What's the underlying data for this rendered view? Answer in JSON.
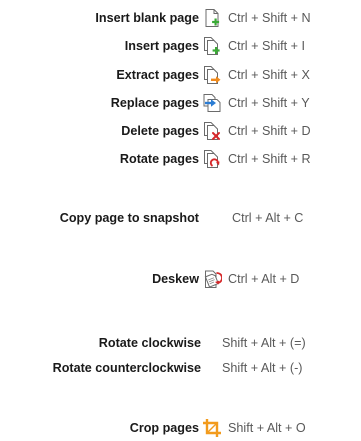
{
  "page_commands": [
    {
      "label": "Insert blank page",
      "shortcut": "Ctrl + Shift + N",
      "icon": "insert-blank-page-icon"
    },
    {
      "label": "Insert pages",
      "shortcut": "Ctrl + Shift + I",
      "icon": "insert-pages-icon"
    },
    {
      "label": "Extract pages",
      "shortcut": "Ctrl + Shift + X",
      "icon": "extract-pages-icon"
    },
    {
      "label": "Replace pages",
      "shortcut": "Ctrl + Shift + Y",
      "icon": "replace-pages-icon"
    },
    {
      "label": "Delete pages",
      "shortcut": "Ctrl + Shift + D",
      "icon": "delete-pages-icon"
    },
    {
      "label": "Rotate pages",
      "shortcut": "Ctrl + Shift + R",
      "icon": "rotate-pages-icon"
    }
  ],
  "snapshot": {
    "label": "Copy page to snapshot",
    "shortcut": "Ctrl + Alt + C"
  },
  "deskew": {
    "label": "Deskew",
    "shortcut": "Ctrl + Alt + D",
    "icon": "deskew-icon"
  },
  "rotate_cw": {
    "label": "Rotate clockwise",
    "shortcut": "Shift + Alt + (=)"
  },
  "rotate_ccw": {
    "label": "Rotate counterclockwise",
    "shortcut": "Shift + Alt + (-)"
  },
  "crop": {
    "label": "Crop pages",
    "shortcut": "Shift + Alt + O",
    "icon": "crop-icon"
  },
  "colors": {
    "label": "#1a1a1a",
    "shortcut": "#595959",
    "green_plus": "#3aaa35",
    "orange_arrow": "#f08a1c",
    "blue_arrow": "#2b7cd3",
    "red_x": "#d6282a",
    "crop_orange": "#f29b1d"
  }
}
